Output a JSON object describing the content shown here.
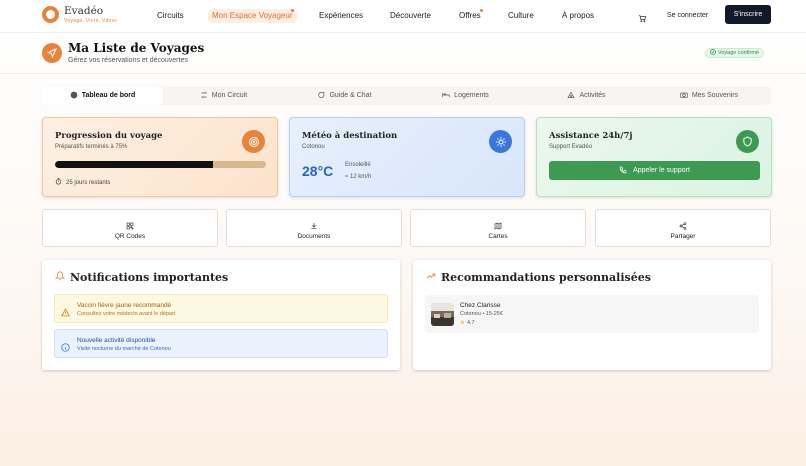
{
  "brand": {
    "name": "Evadéo",
    "tagline": "Voyage. Vivre. Vibrer."
  },
  "nav": {
    "items": [
      {
        "label": "Circuits"
      },
      {
        "label": "Mon Espace Voyageur"
      },
      {
        "label": "Expériences"
      },
      {
        "label": "Découverte"
      },
      {
        "label": "Offres"
      },
      {
        "label": "Culture"
      },
      {
        "label": "À propos"
      }
    ],
    "login_label": "Se connecter",
    "signup_label": "S'inscrire"
  },
  "page": {
    "title": "Ma Liste de Voyages",
    "subtitle": "Gérez vos réservations et découvertes",
    "status_badge": "Voyage confirmé"
  },
  "tabs": [
    {
      "label": "Tableau de bord",
      "icon": "globe-icon"
    },
    {
      "label": "Mon Circuit",
      "icon": "route-icon"
    },
    {
      "label": "Guide & Chat",
      "icon": "chat-icon"
    },
    {
      "label": "Logements",
      "icon": "bed-icon"
    },
    {
      "label": "Activités",
      "icon": "tent-icon"
    },
    {
      "label": "Mes Souvenirs",
      "icon": "camera-icon"
    }
  ],
  "progress_card": {
    "title": "Progression du voyage",
    "subtitle": "Préparatifs terminés à 75%",
    "progress": 0.75,
    "days_remaining": "25 jours restants"
  },
  "weather_card": {
    "title": "Météo à destination",
    "location": "Cotonou",
    "temperature": "28°C",
    "condition": "Ensoleillé",
    "wind": "12 km/h"
  },
  "support_card": {
    "title": "Assistance 24h/7j",
    "subtitle": "Support Evadéo",
    "button_label": "Appeler le support"
  },
  "quick_actions": [
    {
      "label": "QR Codes",
      "icon": "qr-icon"
    },
    {
      "label": "Documents",
      "icon": "download-icon"
    },
    {
      "label": "Cartes",
      "icon": "map-icon"
    },
    {
      "label": "Partager",
      "icon": "share-icon"
    }
  ],
  "notifications": {
    "title": "Notifications importantes",
    "items": [
      {
        "title": "Vaccin fièvre jaune recommandé",
        "desc": "Consultez votre médecin avant le départ"
      },
      {
        "title": "Nouvelle activité disponible",
        "desc": "Visite nocturne du marché de Cotonou"
      }
    ]
  },
  "recommendations": {
    "title": "Recommandations personnalisées",
    "items": [
      {
        "name": "Chez Clarisse",
        "meta": "Cotonou • 15-25€",
        "rating": "4.7"
      }
    ]
  },
  "colors": {
    "accent": "#e8843a",
    "success": "#3e9a52",
    "info": "#2a64c5",
    "dark": "#111827"
  }
}
